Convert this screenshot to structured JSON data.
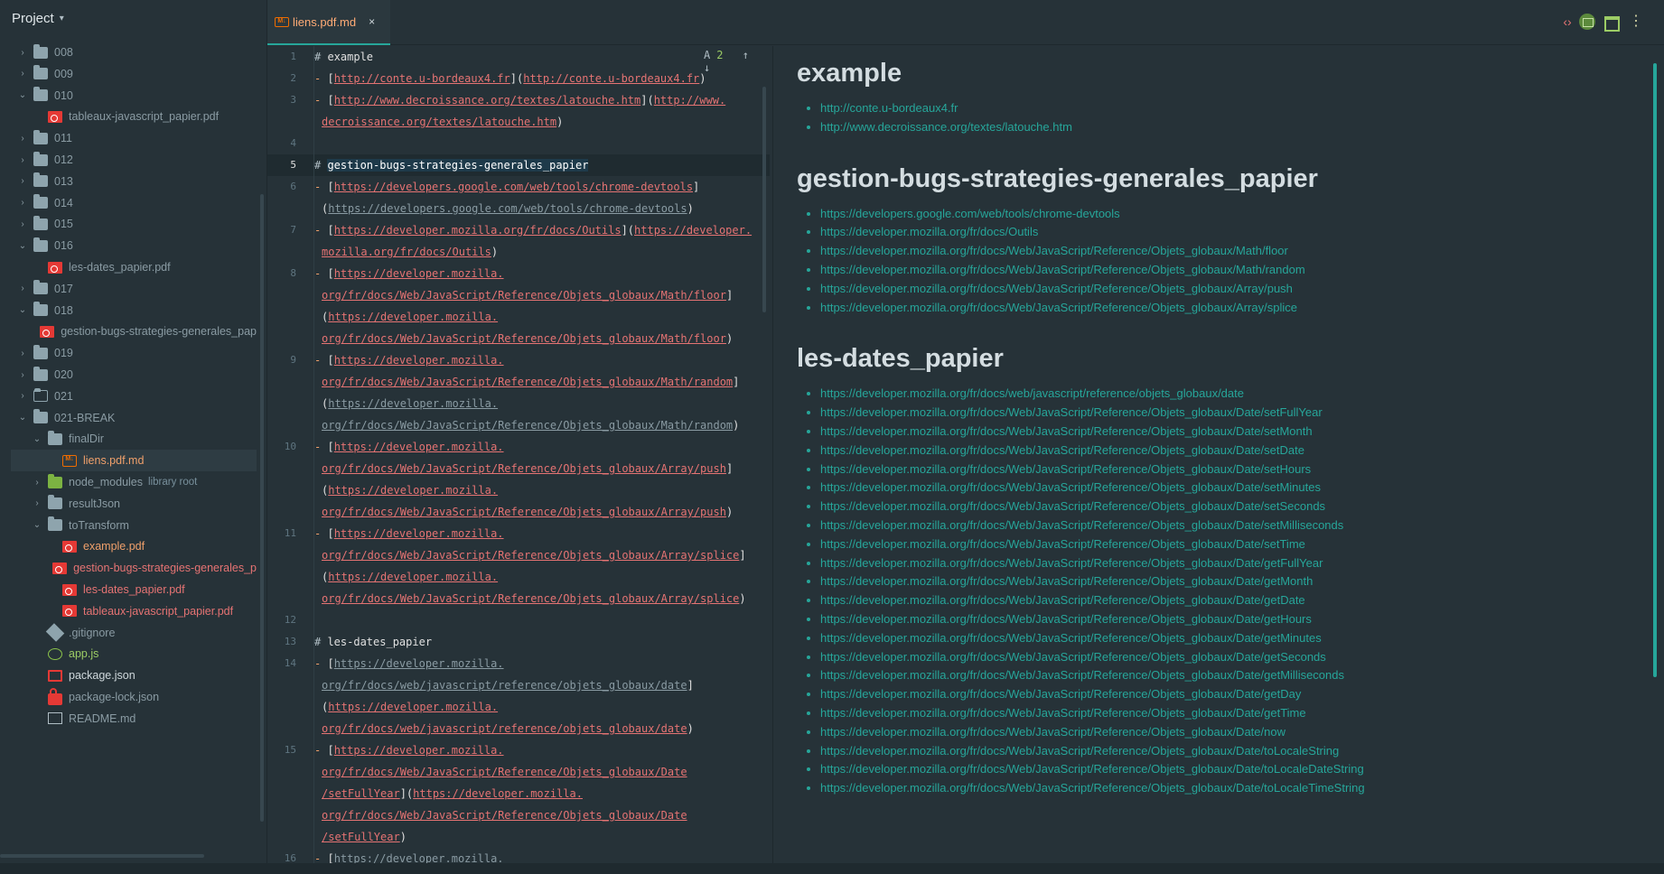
{
  "project": {
    "title": "Project",
    "rows": [
      {
        "label": "008",
        "kind": "folder",
        "expanded": false,
        "depth": 1
      },
      {
        "label": "009",
        "kind": "folder",
        "expanded": false,
        "depth": 1
      },
      {
        "label": "010",
        "kind": "folder",
        "expanded": true,
        "depth": 1
      },
      {
        "label": "tableaux-javascript_papier.pdf",
        "kind": "pdf",
        "depth": 2
      },
      {
        "label": "011",
        "kind": "folder",
        "expanded": false,
        "depth": 1
      },
      {
        "label": "012",
        "kind": "folder",
        "expanded": false,
        "depth": 1
      },
      {
        "label": "013",
        "kind": "folder",
        "expanded": false,
        "depth": 1
      },
      {
        "label": "014",
        "kind": "folder",
        "expanded": false,
        "depth": 1
      },
      {
        "label": "015",
        "kind": "folder",
        "expanded": false,
        "depth": 1
      },
      {
        "label": "016",
        "kind": "folder",
        "expanded": true,
        "depth": 1
      },
      {
        "label": "les-dates_papier.pdf",
        "kind": "pdf",
        "depth": 2
      },
      {
        "label": "017",
        "kind": "folder",
        "expanded": false,
        "depth": 1
      },
      {
        "label": "018",
        "kind": "folder",
        "expanded": true,
        "depth": 1
      },
      {
        "label": "gestion-bugs-strategies-generales_pap",
        "kind": "pdf",
        "depth": 2
      },
      {
        "label": "019",
        "kind": "folder",
        "expanded": false,
        "depth": 1
      },
      {
        "label": "020",
        "kind": "folder",
        "expanded": false,
        "depth": 1
      },
      {
        "label": "021",
        "kind": "folder-outline",
        "expanded": false,
        "depth": 1
      },
      {
        "label": "021-BREAK",
        "kind": "folder",
        "expanded": true,
        "depth": 1
      },
      {
        "label": "finalDir",
        "kind": "folder",
        "expanded": true,
        "depth": 2
      },
      {
        "label": "liens.pdf.md",
        "kind": "md",
        "depth": 3,
        "selected": true
      },
      {
        "label": "node_modules",
        "kind": "folder-green",
        "expanded": false,
        "depth": 2,
        "suffix": "library root"
      },
      {
        "label": "resultJson",
        "kind": "folder",
        "expanded": false,
        "depth": 2
      },
      {
        "label": "toTransform",
        "kind": "folder",
        "expanded": true,
        "depth": 2
      },
      {
        "label": "example.pdf",
        "kind": "pdf",
        "depth": 3,
        "color": "orange"
      },
      {
        "label": "gestion-bugs-strategies-generales_p",
        "kind": "pdf",
        "depth": 3,
        "color": "red"
      },
      {
        "label": "les-dates_papier.pdf",
        "kind": "pdf",
        "depth": 3,
        "color": "red"
      },
      {
        "label": "tableaux-javascript_papier.pdf",
        "kind": "pdf",
        "depth": 3,
        "color": "red"
      },
      {
        "label": ".gitignore",
        "kind": "git",
        "depth": 2
      },
      {
        "label": "app.js",
        "kind": "js",
        "depth": 2
      },
      {
        "label": "package.json",
        "kind": "json",
        "depth": 2
      },
      {
        "label": "package-lock.json",
        "kind": "lock",
        "depth": 2
      },
      {
        "label": "README.md",
        "kind": "readme",
        "depth": 2
      }
    ]
  },
  "tab": {
    "label": "liens.pdf.md",
    "close": "×"
  },
  "toolbar_icons": [
    "code-view-icon",
    "split-view-icon",
    "preview-only-icon",
    "more-icon"
  ],
  "editor": {
    "tools": {
      "spell": "A",
      "count": "2",
      "up": "↑",
      "down": "↓"
    },
    "current_line": "5",
    "lines": [
      {
        "n": "1",
        "segs": [
          [
            "hash",
            "# "
          ],
          [
            "head-txt",
            "example"
          ]
        ]
      },
      {
        "n": "2",
        "segs": [
          [
            "dash",
            "- "
          ],
          [
            "br",
            "["
          ],
          [
            "u-bright",
            "http://conte.u-bordeaux4.fr"
          ],
          [
            "br",
            "]("
          ],
          [
            "u-bright",
            "http://conte.u-bordeaux4.fr"
          ],
          [
            "br",
            ")"
          ]
        ]
      },
      {
        "n": "3",
        "segs": [
          [
            "dash",
            "- "
          ],
          [
            "br",
            "["
          ],
          [
            "u-bright",
            "http://www.decroissance.org/textes/latouche.htm"
          ],
          [
            "br",
            "]("
          ],
          [
            "u-bright",
            "http://www."
          ]
        ]
      },
      {
        "n": "",
        "cont": true,
        "segs": [
          [
            "u-bright",
            "decroissance.org/textes/latouche.htm"
          ],
          [
            "br",
            ")"
          ]
        ]
      },
      {
        "n": "4",
        "segs": []
      },
      {
        "n": "5",
        "segs": [
          [
            "hash",
            "# "
          ],
          [
            "head-sel",
            "gestion-bugs-strategies-generales_papier"
          ]
        ]
      },
      {
        "n": "6",
        "segs": [
          [
            "dash",
            "- "
          ],
          [
            "br",
            "["
          ],
          [
            "u-bright",
            "https://developers.google.com/web/tools/chrome-devtools"
          ],
          [
            "br",
            "]"
          ]
        ]
      },
      {
        "n": "",
        "cont": true,
        "segs": [
          [
            "br",
            "("
          ],
          [
            "u-dim",
            "https://developers.google.com/web/tools/chrome-devtools"
          ],
          [
            "br",
            ")"
          ]
        ]
      },
      {
        "n": "7",
        "segs": [
          [
            "dash",
            "- "
          ],
          [
            "br",
            "["
          ],
          [
            "u-bright",
            "https://developer.mozilla.org/fr/docs/Outils"
          ],
          [
            "br",
            "]("
          ],
          [
            "u-bright",
            "https://developer."
          ]
        ]
      },
      {
        "n": "",
        "cont": true,
        "segs": [
          [
            "u-bright",
            "mozilla.org/fr/docs/Outils"
          ],
          [
            "br",
            ")"
          ]
        ]
      },
      {
        "n": "8",
        "segs": [
          [
            "dash",
            "- "
          ],
          [
            "br",
            "["
          ],
          [
            "u-bright",
            "https://developer.mozilla."
          ]
        ]
      },
      {
        "n": "",
        "cont": true,
        "segs": [
          [
            "u-bright",
            "org/fr/docs/Web/JavaScript/Reference/Objets_globaux/Math/floor"
          ],
          [
            "br",
            "]"
          ]
        ]
      },
      {
        "n": "",
        "cont": true,
        "segs": [
          [
            "br",
            "("
          ],
          [
            "u-bright",
            "https://developer.mozilla."
          ]
        ]
      },
      {
        "n": "",
        "cont": true,
        "segs": [
          [
            "u-bright",
            "org/fr/docs/Web/JavaScript/Reference/Objets_globaux/Math/floor"
          ],
          [
            "br",
            ")"
          ]
        ]
      },
      {
        "n": "9",
        "segs": [
          [
            "dash",
            "- "
          ],
          [
            "br",
            "["
          ],
          [
            "u-bright",
            "https://developer.mozilla."
          ]
        ]
      },
      {
        "n": "",
        "cont": true,
        "segs": [
          [
            "u-bright",
            "org/fr/docs/Web/JavaScript/Reference/Objets_globaux/Math/random"
          ],
          [
            "br",
            "]"
          ]
        ]
      },
      {
        "n": "",
        "cont": true,
        "segs": [
          [
            "br",
            "("
          ],
          [
            "u-dim",
            "https://developer.mozilla."
          ]
        ]
      },
      {
        "n": "",
        "cont": true,
        "segs": [
          [
            "u-dim",
            "org/fr/docs/Web/JavaScript/Reference/Objets_globaux/Math/random"
          ],
          [
            "br",
            ")"
          ]
        ]
      },
      {
        "n": "10",
        "segs": [
          [
            "dash",
            "- "
          ],
          [
            "br",
            "["
          ],
          [
            "u-bright",
            "https://developer.mozilla."
          ]
        ]
      },
      {
        "n": "",
        "cont": true,
        "segs": [
          [
            "u-bright",
            "org/fr/docs/Web/JavaScript/Reference/Objets_globaux/Array/push"
          ],
          [
            "br",
            "]"
          ]
        ]
      },
      {
        "n": "",
        "cont": true,
        "segs": [
          [
            "br",
            "("
          ],
          [
            "u-bright",
            "https://developer.mozilla."
          ]
        ]
      },
      {
        "n": "",
        "cont": true,
        "segs": [
          [
            "u-bright",
            "org/fr/docs/Web/JavaScript/Reference/Objets_globaux/Array/push"
          ],
          [
            "br",
            ")"
          ]
        ]
      },
      {
        "n": "11",
        "segs": [
          [
            "dash",
            "- "
          ],
          [
            "br",
            "["
          ],
          [
            "u-bright",
            "https://developer.mozilla."
          ]
        ]
      },
      {
        "n": "",
        "cont": true,
        "segs": [
          [
            "u-bright",
            "org/fr/docs/Web/JavaScript/Reference/Objets_globaux/Array/splice"
          ],
          [
            "br",
            "]"
          ]
        ]
      },
      {
        "n": "",
        "cont": true,
        "segs": [
          [
            "br",
            "("
          ],
          [
            "u-bright",
            "https://developer.mozilla."
          ]
        ]
      },
      {
        "n": "",
        "cont": true,
        "segs": [
          [
            "u-bright",
            "org/fr/docs/Web/JavaScript/Reference/Objets_globaux/Array/splice"
          ],
          [
            "br",
            ")"
          ]
        ]
      },
      {
        "n": "12",
        "segs": []
      },
      {
        "n": "13",
        "segs": [
          [
            "hash",
            "# "
          ],
          [
            "head-txt",
            "les-dates_papier"
          ]
        ]
      },
      {
        "n": "14",
        "segs": [
          [
            "dash",
            "- "
          ],
          [
            "br",
            "["
          ],
          [
            "u-dim",
            "https://developer.mozilla."
          ]
        ]
      },
      {
        "n": "",
        "cont": true,
        "segs": [
          [
            "u-dim",
            "org/fr/docs/web/javascript/reference/objets_globaux/date"
          ],
          [
            "br",
            "]"
          ]
        ]
      },
      {
        "n": "",
        "cont": true,
        "segs": [
          [
            "br",
            "("
          ],
          [
            "u-bright",
            "https://developer.mozilla."
          ]
        ]
      },
      {
        "n": "",
        "cont": true,
        "segs": [
          [
            "u-bright",
            "org/fr/docs/web/javascript/reference/objets_globaux/date"
          ],
          [
            "br",
            ")"
          ]
        ]
      },
      {
        "n": "15",
        "segs": [
          [
            "dash",
            "- "
          ],
          [
            "br",
            "["
          ],
          [
            "u-bright",
            "https://developer.mozilla."
          ]
        ]
      },
      {
        "n": "",
        "cont": true,
        "segs": [
          [
            "u-bright",
            "org/fr/docs/Web/JavaScript/Reference/Objets_globaux/Date"
          ]
        ]
      },
      {
        "n": "",
        "cont": true,
        "segs": [
          [
            "u-bright",
            "/setFullYear"
          ],
          [
            "br",
            "]("
          ],
          [
            "u-bright",
            "https://developer.mozilla."
          ]
        ]
      },
      {
        "n": "",
        "cont": true,
        "segs": [
          [
            "u-bright",
            "org/fr/docs/Web/JavaScript/Reference/Objets_globaux/Date"
          ]
        ]
      },
      {
        "n": "",
        "cont": true,
        "segs": [
          [
            "u-bright",
            "/setFullYear"
          ],
          [
            "br",
            ")"
          ]
        ]
      },
      {
        "n": "16",
        "segs": [
          [
            "dash",
            "- "
          ],
          [
            "br",
            "["
          ],
          [
            "u-dim",
            "https://developer.mozilla."
          ]
        ]
      }
    ]
  },
  "preview": {
    "sections": [
      {
        "heading": "example",
        "links": [
          "http://conte.u-bordeaux4.fr",
          "http://www.decroissance.org/textes/latouche.htm"
        ]
      },
      {
        "heading": "gestion-bugs-strategies-generales_papier",
        "links": [
          "https://developers.google.com/web/tools/chrome-devtools",
          "https://developer.mozilla.org/fr/docs/Outils",
          "https://developer.mozilla.org/fr/docs/Web/JavaScript/Reference/Objets_globaux/Math/floor",
          "https://developer.mozilla.org/fr/docs/Web/JavaScript/Reference/Objets_globaux/Math/random",
          "https://developer.mozilla.org/fr/docs/Web/JavaScript/Reference/Objets_globaux/Array/push",
          "https://developer.mozilla.org/fr/docs/Web/JavaScript/Reference/Objets_globaux/Array/splice"
        ]
      },
      {
        "heading": "les-dates_papier",
        "links": [
          "https://developer.mozilla.org/fr/docs/web/javascript/reference/objets_globaux/date",
          "https://developer.mozilla.org/fr/docs/Web/JavaScript/Reference/Objets_globaux/Date/setFullYear",
          "https://developer.mozilla.org/fr/docs/Web/JavaScript/Reference/Objets_globaux/Date/setMonth",
          "https://developer.mozilla.org/fr/docs/Web/JavaScript/Reference/Objets_globaux/Date/setDate",
          "https://developer.mozilla.org/fr/docs/Web/JavaScript/Reference/Objets_globaux/Date/setHours",
          "https://developer.mozilla.org/fr/docs/Web/JavaScript/Reference/Objets_globaux/Date/setMinutes",
          "https://developer.mozilla.org/fr/docs/Web/JavaScript/Reference/Objets_globaux/Date/setSeconds",
          "https://developer.mozilla.org/fr/docs/Web/JavaScript/Reference/Objets_globaux/Date/setMilliseconds",
          "https://developer.mozilla.org/fr/docs/Web/JavaScript/Reference/Objets_globaux/Date/setTime",
          "https://developer.mozilla.org/fr/docs/Web/JavaScript/Reference/Objets_globaux/Date/getFullYear",
          "https://developer.mozilla.org/fr/docs/Web/JavaScript/Reference/Objets_globaux/Date/getMonth",
          "https://developer.mozilla.org/fr/docs/Web/JavaScript/Reference/Objets_globaux/Date/getDate",
          "https://developer.mozilla.org/fr/docs/Web/JavaScript/Reference/Objets_globaux/Date/getHours",
          "https://developer.mozilla.org/fr/docs/Web/JavaScript/Reference/Objets_globaux/Date/getMinutes",
          "https://developer.mozilla.org/fr/docs/Web/JavaScript/Reference/Objets_globaux/Date/getSeconds",
          "https://developer.mozilla.org/fr/docs/Web/JavaScript/Reference/Objets_globaux/Date/getMilliseconds",
          "https://developer.mozilla.org/fr/docs/Web/JavaScript/Reference/Objets_globaux/Date/getDay",
          "https://developer.mozilla.org/fr/docs/Web/JavaScript/Reference/Objets_globaux/Date/getTime",
          "https://developer.mozilla.org/fr/docs/Web/JavaScript/Reference/Objets_globaux/Date/now",
          "https://developer.mozilla.org/fr/docs/Web/JavaScript/Reference/Objets_globaux/Date/toLocaleString",
          "https://developer.mozilla.org/fr/docs/Web/JavaScript/Reference/Objets_globaux/Date/toLocaleDateString",
          "https://developer.mozilla.org/fr/docs/Web/JavaScript/Reference/Objets_globaux/Date/toLocaleTimeString"
        ]
      }
    ]
  },
  "colors": {
    "accent": "#26a69a",
    "link": "#26a69a",
    "md_link": "#e57373",
    "background": "#263238"
  }
}
